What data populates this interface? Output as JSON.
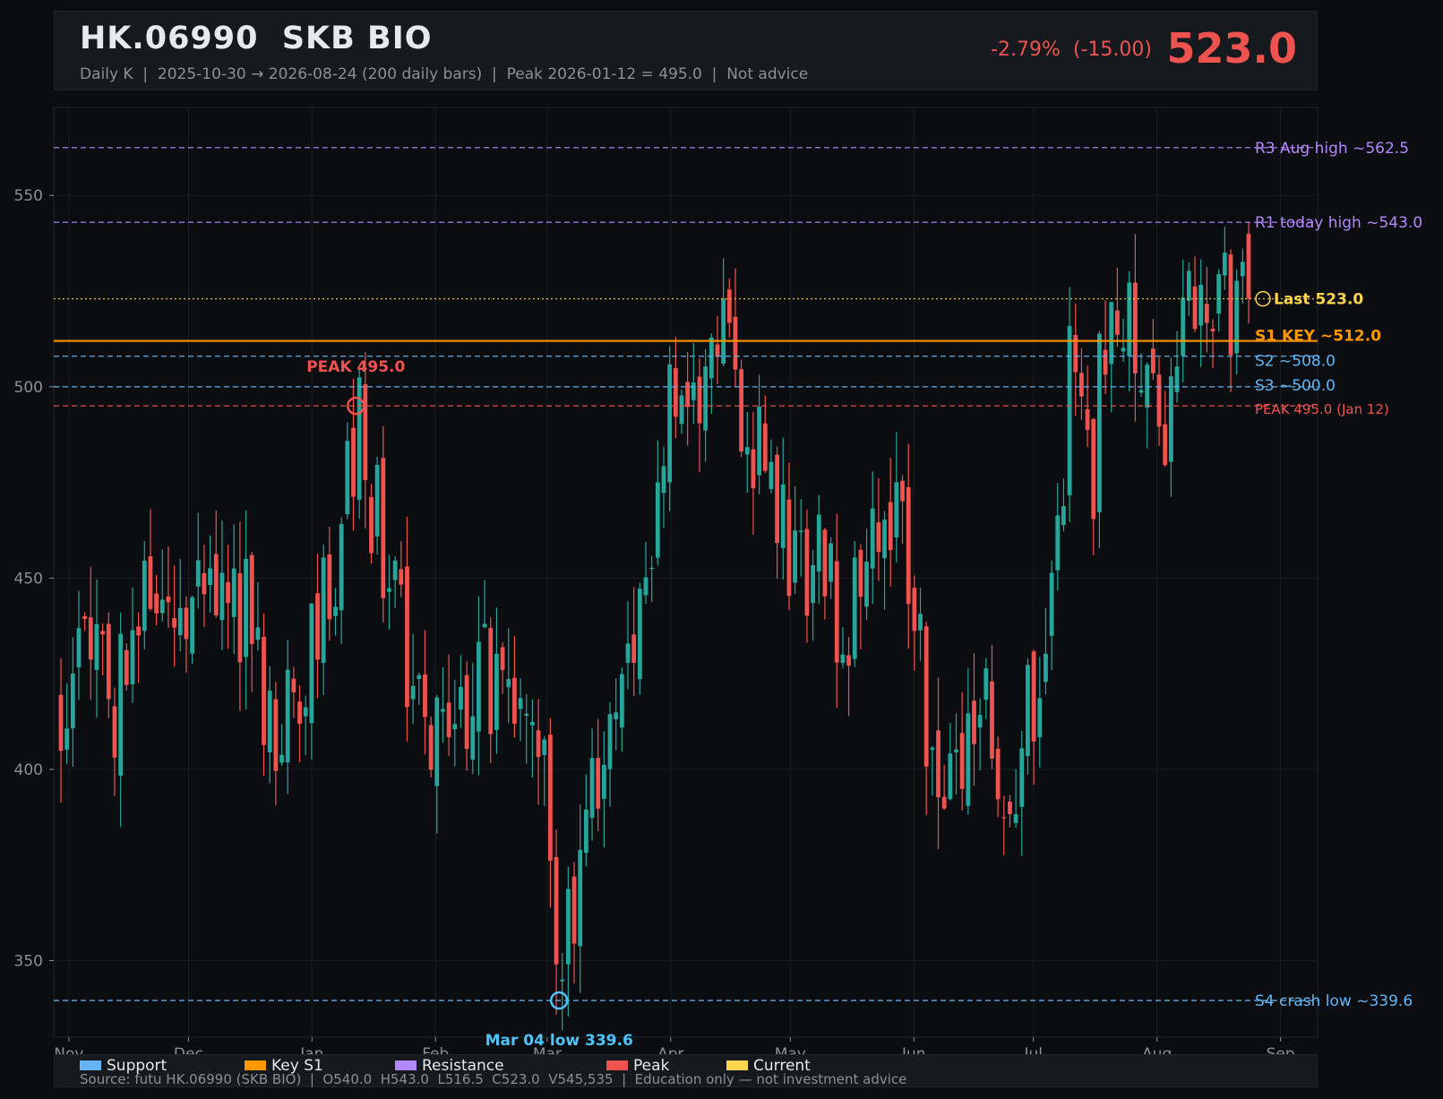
{
  "header": {
    "title": "HK.06990  SKB BIO",
    "subtitle": "Daily K  |  2025-10-30 → 2026-08-24 (200 daily bars)  |  Peak 2026-01-12 = 495.0  |  Not advice",
    "change": "-2.79%  (-15.00)",
    "price": "523.0"
  },
  "legend": {
    "items": [
      {
        "label": "Support",
        "color": "#64b5f6"
      },
      {
        "label": "Key S1",
        "color": "#ff9800"
      },
      {
        "label": "Resistance",
        "color": "#b388ff"
      },
      {
        "label": "Peak",
        "color": "#ef5350"
      },
      {
        "label": "Current",
        "color": "#ffd54f"
      }
    ],
    "source": "Source: futu HK.06990 (SKB BIO)  |  O540.0  H543.0  L516.5  C523.0  V545,535  |  Education only — not investment advice"
  },
  "colors": {
    "up": "#26a69a",
    "down": "#ef5350",
    "grid": "#1a1e23",
    "axis": "#8b9098"
  },
  "chart_data": {
    "type": "candlestick",
    "ylim": [
      330,
      573
    ],
    "yticks": [
      350,
      400,
      450,
      500,
      550
    ],
    "xticks": [
      {
        "label": "Nov",
        "date": "2025-11-01"
      },
      {
        "label": "Dec",
        "date": "2025-12-01"
      },
      {
        "label": "Jan",
        "date": "2026-01-01"
      },
      {
        "label": "Feb",
        "date": "2026-02-01"
      },
      {
        "label": "Mar",
        "date": "2026-03-01"
      },
      {
        "label": "Apr",
        "date": "2026-04-01"
      },
      {
        "label": "May",
        "date": "2026-05-01"
      },
      {
        "label": "Jun",
        "date": "2026-06-01"
      },
      {
        "label": "Jul",
        "date": "2026-07-01"
      },
      {
        "label": "Aug",
        "date": "2026-08-01"
      },
      {
        "label": "Sep",
        "date": "2026-09-01"
      }
    ],
    "date_range": [
      "2025-10-30",
      "2026-08-24"
    ],
    "levels": [
      {
        "label": "R3 Aug high ~562.5",
        "value": 562.5,
        "color": "#b388ff",
        "style": "dashed"
      },
      {
        "label": "R1 today high ~543.0",
        "value": 543.0,
        "color": "#b388ff",
        "style": "dashed"
      },
      {
        "label": "Last 523.0",
        "value": 523.0,
        "color": "#ffd54f",
        "style": "dotted"
      },
      {
        "label": "S1 KEY ~512.0",
        "value": 512.0,
        "color": "#ff9800",
        "style": "solid"
      },
      {
        "label": "S2 ~508.0",
        "value": 508.0,
        "color": "#64b5f6",
        "style": "dashed"
      },
      {
        "label": "S3 ~500.0",
        "value": 500.0,
        "color": "#64b5f6",
        "style": "dashed"
      },
      {
        "label": "PEAK 495.0 (Jan 12)",
        "value": 495.0,
        "color": "#ef5350",
        "style": "dashed"
      },
      {
        "label": "S4 crash low ~339.6",
        "value": 339.6,
        "color": "#64b5f6",
        "style": "dashed"
      }
    ],
    "annotations": [
      {
        "label": "PEAK 495.0",
        "date": "2026-01-12",
        "value": 495.0,
        "color": "#ef5350"
      },
      {
        "label": "Mar 04 low 339.6",
        "date": "2026-03-04",
        "value": 339.6,
        "color": "#4fc3f7"
      }
    ],
    "last": {
      "open": 540.0,
      "high": 543.0,
      "low": 516.5,
      "close": 523.0,
      "volume": 545535
    },
    "close_path": [
      [
        "2025-10-30",
        420
      ],
      [
        "2025-11-05",
        445
      ],
      [
        "2025-11-12",
        412
      ],
      [
        "2025-11-18",
        452
      ],
      [
        "2025-11-25",
        430
      ],
      [
        "2025-12-02",
        455
      ],
      [
        "2025-12-08",
        440
      ],
      [
        "2025-12-15",
        445
      ],
      [
        "2025-12-22",
        405
      ],
      [
        "2025-12-29",
        415
      ],
      [
        "2026-01-05",
        448
      ],
      [
        "2026-01-12",
        490
      ],
      [
        "2026-01-19",
        460
      ],
      [
        "2026-01-26",
        420
      ],
      [
        "2026-02-02",
        410
      ],
      [
        "2026-02-09",
        420
      ],
      [
        "2026-02-16",
        425
      ],
      [
        "2026-02-23",
        405
      ],
      [
        "2026-03-01",
        390
      ],
      [
        "2026-03-04",
        350
      ],
      [
        "2026-03-10",
        375
      ],
      [
        "2026-03-17",
        410
      ],
      [
        "2026-03-24",
        430
      ],
      [
        "2026-03-31",
        495
      ],
      [
        "2026-04-07",
        485
      ],
      [
        "2026-04-14",
        515
      ],
      [
        "2026-04-20",
        495
      ],
      [
        "2026-04-27",
        470
      ],
      [
        "2026-05-04",
        455
      ],
      [
        "2026-05-12",
        445
      ],
      [
        "2026-05-19",
        440
      ],
      [
        "2026-05-26",
        470
      ],
      [
        "2026-06-01",
        455
      ],
      [
        "2026-06-05",
        400
      ],
      [
        "2026-06-12",
        390
      ],
      [
        "2026-06-19",
        420
      ],
      [
        "2026-06-26",
        395
      ],
      [
        "2026-07-03",
        430
      ],
      [
        "2026-07-10",
        500
      ],
      [
        "2026-07-16",
        480
      ],
      [
        "2026-07-20",
        530
      ],
      [
        "2026-07-27",
        505
      ],
      [
        "2026-08-03",
        490
      ],
      [
        "2026-08-10",
        530
      ],
      [
        "2026-08-17",
        525
      ],
      [
        "2026-08-24",
        523
      ]
    ]
  }
}
